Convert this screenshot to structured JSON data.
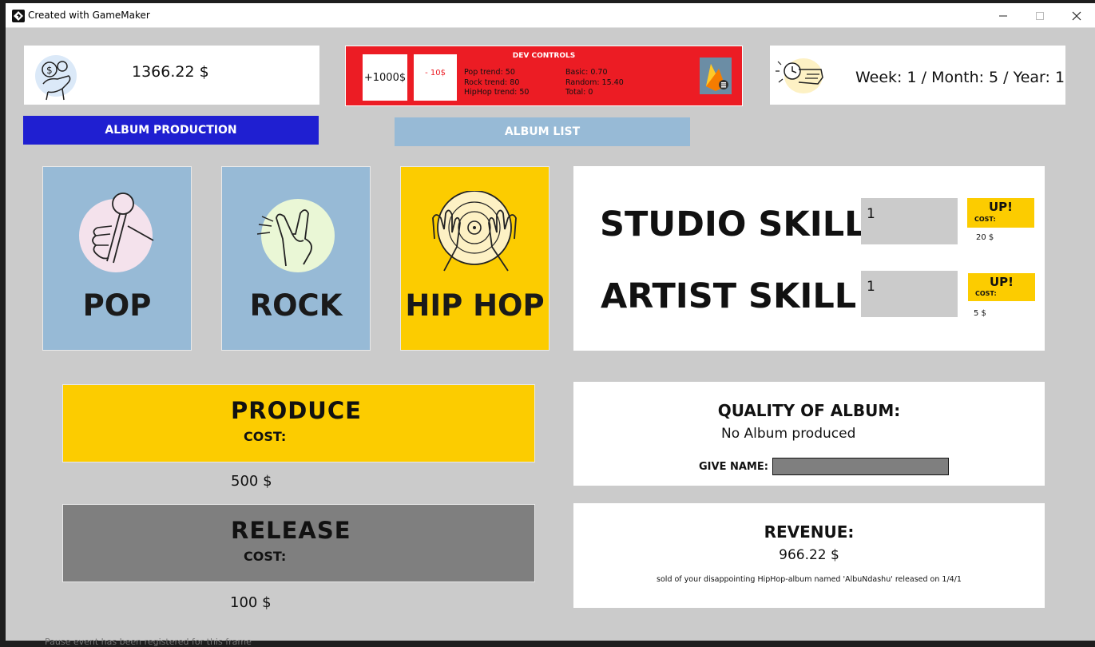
{
  "window": {
    "title": "Created with GameMaker"
  },
  "header": {
    "money": "1366.22 $",
    "date": "Week: 1 / Month: 5 / Year: 1"
  },
  "nav": {
    "album_production": "ALBUM PRODUCTION",
    "album_list": "ALBUM LIST"
  },
  "dev_controls": {
    "title": "DEV CONTROLS",
    "add_money": "+1000$",
    "minus_money": "- 10$",
    "pop_trend": "Pop trend: 50",
    "rock_trend": "Rock trend: 80",
    "hiphop_trend": "HipHop trend: 50",
    "basic": "Basic: 0.70",
    "random": "Random: 15.40",
    "total": "Total: 0"
  },
  "genres": [
    {
      "label": "POP",
      "color": "#97bad6",
      "icon": "microphone-hand-icon"
    },
    {
      "label": "ROCK",
      "color": "#97bad6",
      "icon": "rock-hand-icon"
    },
    {
      "label": "HIP HOP",
      "color": "#fccc00",
      "icon": "vinyl-hands-icon"
    }
  ],
  "skills": {
    "studio_label": "STUDIO SKILL",
    "studio_value": "1",
    "studio_cost": "20 $",
    "artist_label": "ARTIST SKILL",
    "artist_value": "1",
    "artist_cost": "5 $",
    "up_label": "UP!",
    "cost_label": "COST:"
  },
  "produce": {
    "label": "PRODUCE",
    "cost_label": "COST:",
    "price": "500 $",
    "color": "#fccc00"
  },
  "release": {
    "label": "RELEASE",
    "cost_label": "COST:",
    "price": "100 $",
    "color": "#7f7f7f"
  },
  "quality": {
    "title": "QUALITY OF ALBUM:",
    "value": "No Album produced",
    "give_name_label": "GIVE NAME:",
    "name_value": ""
  },
  "revenue": {
    "title": "REVENUE:",
    "value": "966.22 $",
    "message": "sold of your disappointing HipHop-album named 'AlbuNdashu' released on 1/4/1"
  },
  "console": {
    "text": "Pause event has been registered for this frame"
  }
}
